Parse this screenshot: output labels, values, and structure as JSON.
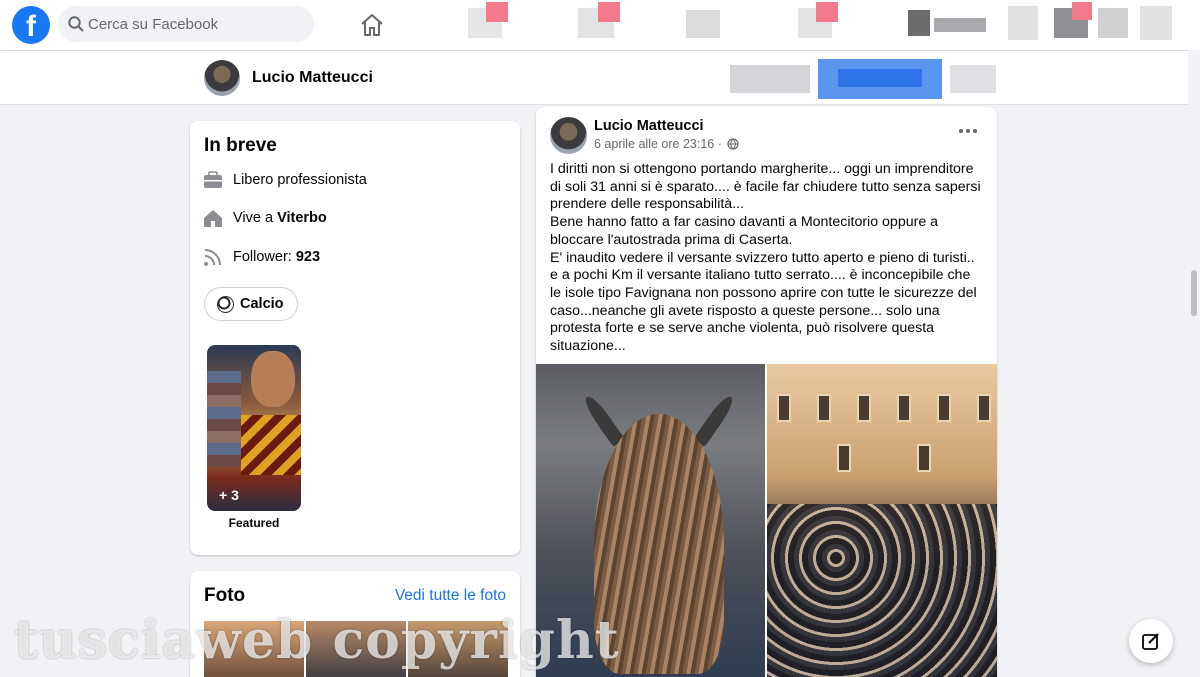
{
  "topbar": {
    "logo_letter": "f",
    "search_placeholder": "Cerca su Facebook"
  },
  "profile_header": {
    "name": "Lucio Matteucci"
  },
  "intro": {
    "title": "In breve",
    "work": "Libero professionista",
    "lives_prefix": "Vive a ",
    "lives_city": "Viterbo",
    "followers_prefix": "Follower: ",
    "followers_count": "923",
    "hobby": "Calcio",
    "featured_count": "+ 3",
    "featured_label": "Featured"
  },
  "photos": {
    "title": "Foto",
    "see_all": "Vedi tutte le foto"
  },
  "post": {
    "author": "Lucio Matteucci",
    "date": "6 aprile alle ore 23:16 ·",
    "text": "I diritti non si ottengono portando margherite... oggi un imprenditore\ndi soli 31 anni si è sparato.... è facile far chiudere tutto senza sapersi\nprendere delle responsabilità...\nBene hanno fatto a far casino davanti a Montecitorio oppure a\nbloccare l'autostrada prima di Caserta.\nE' inaudito vedere il versante svizzero tutto aperto e pieno di turisti..\ne a pochi Km il versante italiano tutto serrato.... è inconcepibile che\nle isole tipo Favignana  non possono aprire con tutte le sicurezze del\ncaso...neanche gli avete risposto a queste persone... solo una\nprotesta forte e se serve anche violenta, può risolvere questa\nsituazione..."
  },
  "watermark": "tusciaweb copyright",
  "colors": {
    "brand": "#1877f2",
    "link": "#1b74e4",
    "background": "#f0f2f5"
  }
}
